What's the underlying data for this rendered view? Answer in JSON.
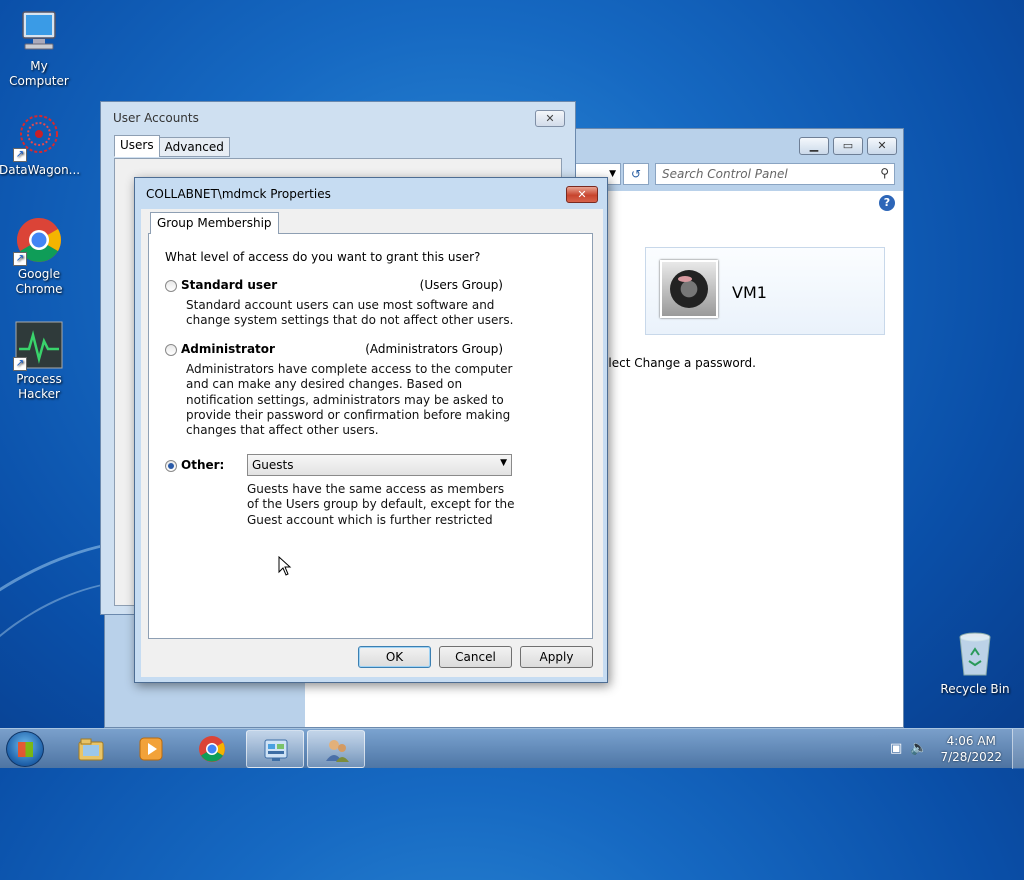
{
  "desktop": {
    "icons": [
      {
        "label": "My Computer",
        "icon": "computer-icon"
      },
      {
        "label": "DataWagon...",
        "icon": "datawagon-icon"
      },
      {
        "label": "Google Chrome",
        "icon": "chrome-icon"
      },
      {
        "label": "Process Hacker",
        "icon": "process-hacker-icon"
      },
      {
        "label": "Recycle Bin",
        "icon": "recycle-bin-icon"
      }
    ]
  },
  "control_panel": {
    "search_placeholder": "Search Control Panel",
    "user_name": "VM1",
    "hint_text": "elect Change a password.",
    "help_glyph": "?"
  },
  "user_accounts": {
    "title": "User Accounts",
    "tabs": [
      "Users",
      "Advanced"
    ],
    "active_tab": "Users"
  },
  "properties": {
    "title": "COLLABNET\\mdmck Properties",
    "tab": "Group Membership",
    "question": "What level of access do you want to grant this user?",
    "options": [
      {
        "label": "Standard user",
        "group": "(Users Group)",
        "desc": "Standard account users can use most software and change system settings that do not affect other users.",
        "checked": false
      },
      {
        "label": "Administrator",
        "group": "(Administrators Group)",
        "desc": "Administrators have complete access to the computer and can make any desired changes. Based on notification settings, administrators may be asked to provide their password or confirmation before making changes that affect other users.",
        "checked": false
      },
      {
        "label": "Other:",
        "group": "",
        "desc": "",
        "checked": true
      }
    ],
    "other_select_value": "Guests",
    "other_desc": "Guests have the same access as members of the Users group by default, except for the Guest account which is further restricted",
    "buttons": {
      "ok": "OK",
      "cancel": "Cancel",
      "apply": "Apply"
    }
  },
  "taskbar": {
    "items": [
      "windows-explorer-icon",
      "media-player-icon",
      "chrome-icon",
      "control-panel-icon",
      "user-accounts-icon"
    ],
    "active_item": "control-panel-icon",
    "clock_time": "4:06 AM",
    "clock_date": "7/28/2022"
  },
  "colors": {
    "desktop_blue": "#1669c2",
    "dialog_frame": "#c6dcf2",
    "close_red": "#c8452e"
  }
}
